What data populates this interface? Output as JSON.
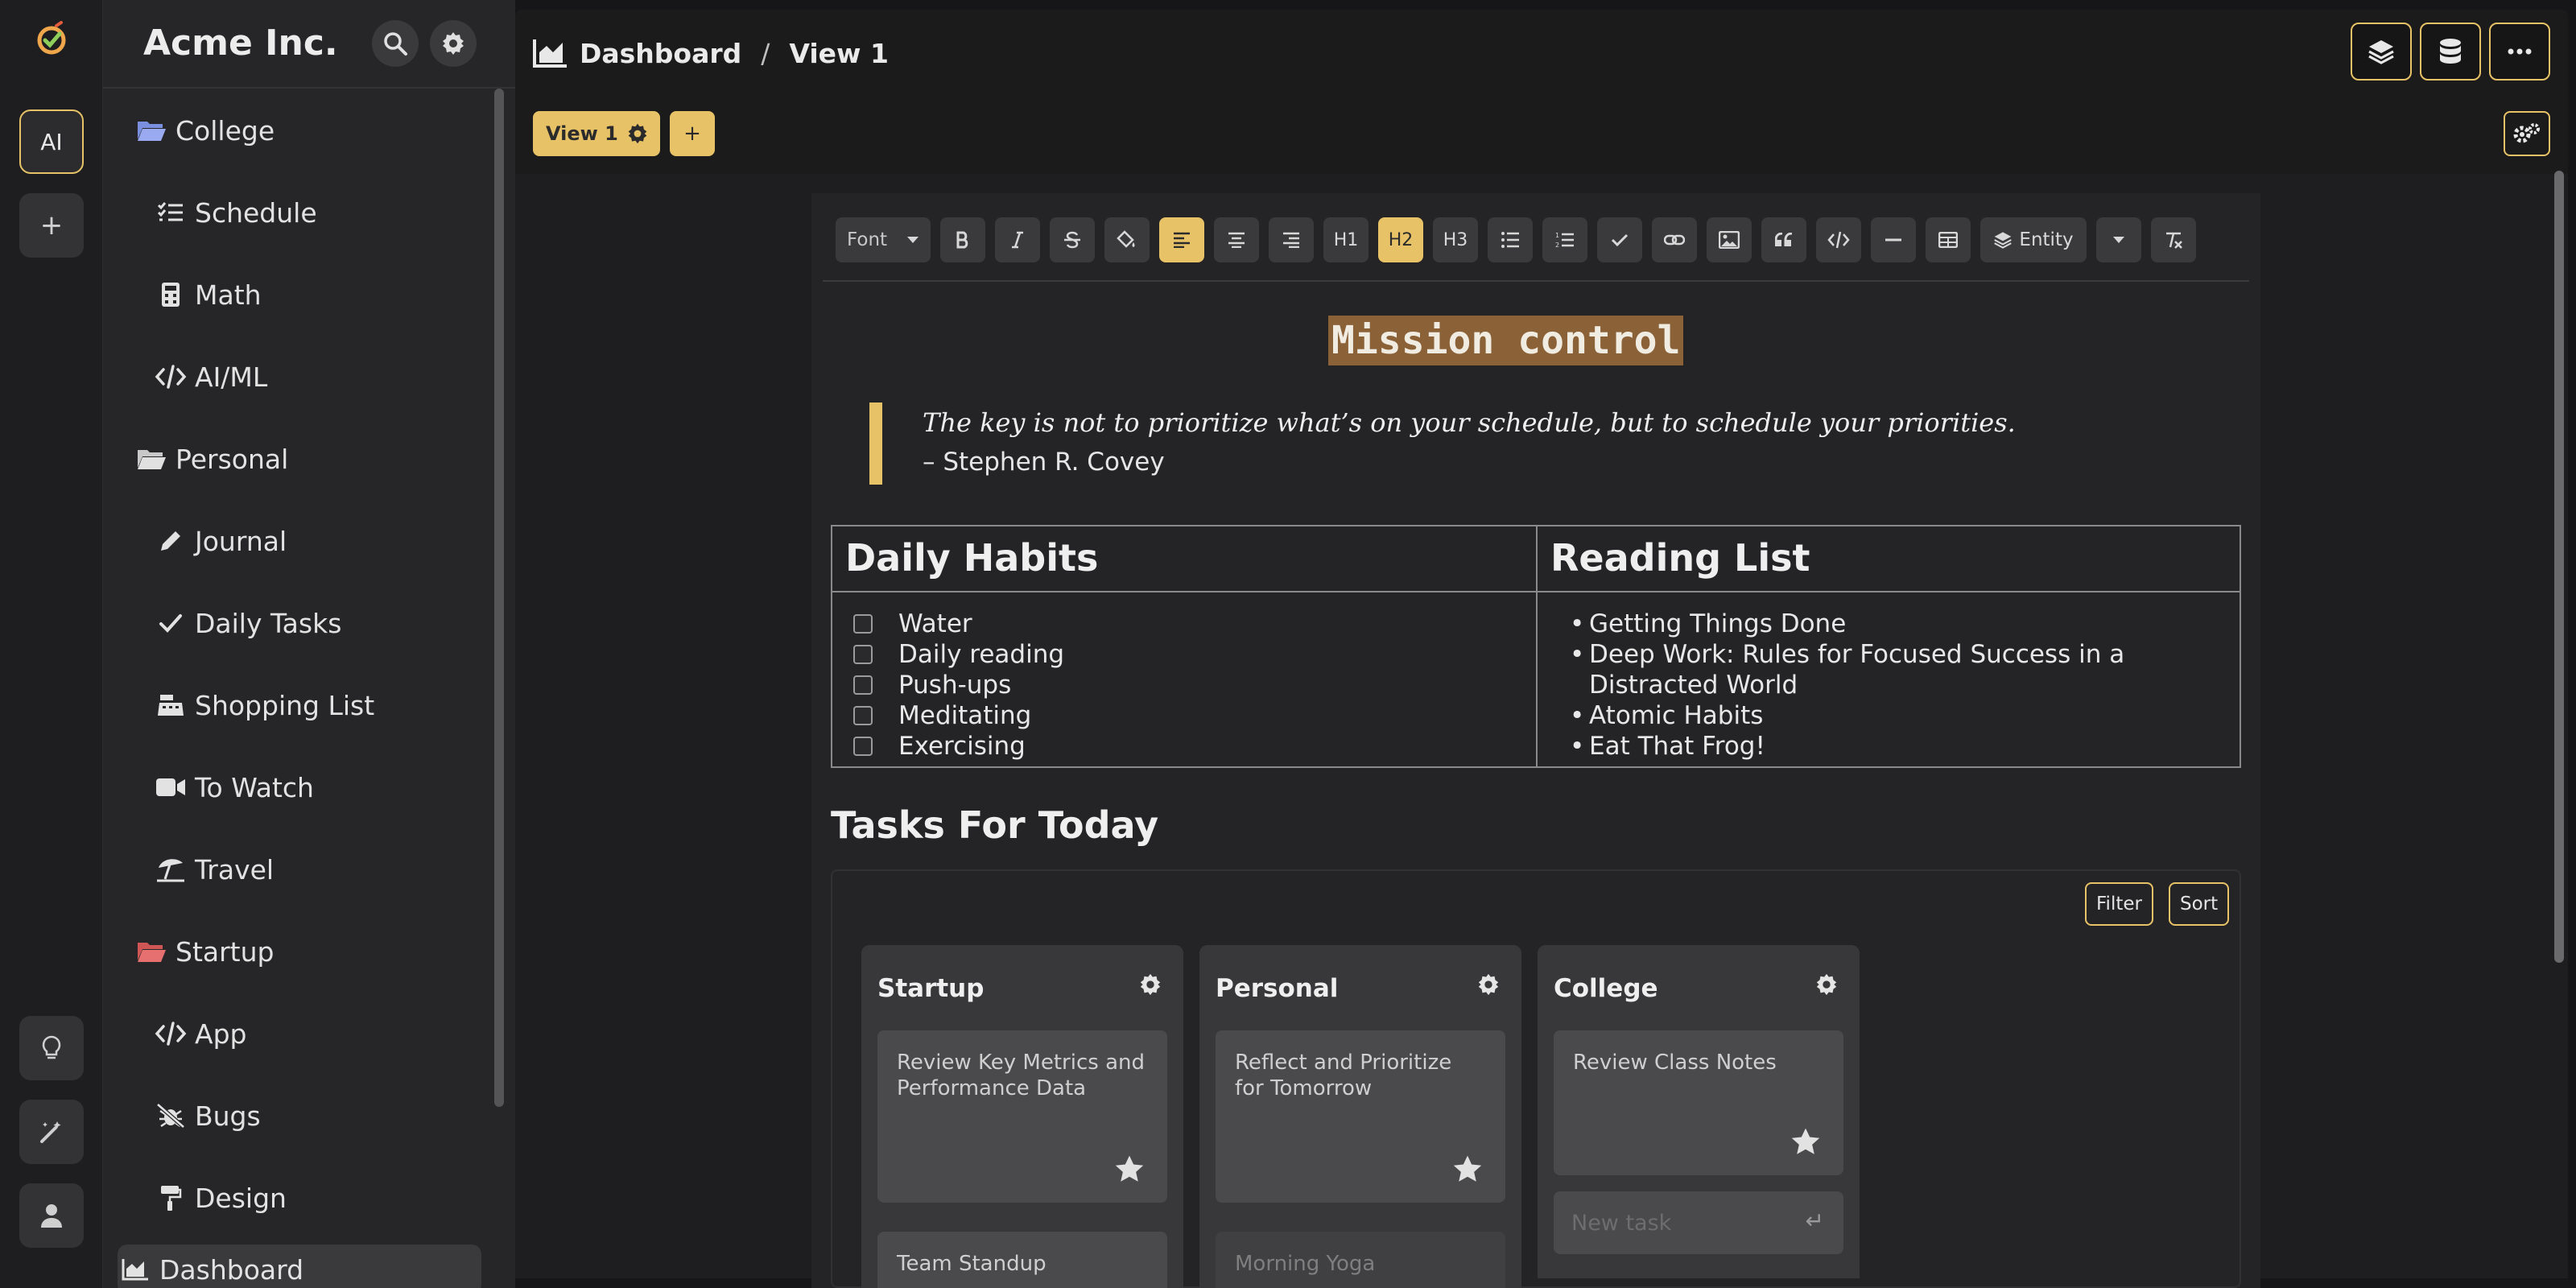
{
  "rail": {
    "ai_label": "AI",
    "add_label": "+"
  },
  "sidebar": {
    "org_name": "Acme Inc.",
    "items": [
      {
        "label": "College",
        "icon": "folder-open-icon",
        "color": "#7b8fe0"
      },
      {
        "label": "Schedule",
        "icon": "list-check-icon"
      },
      {
        "label": "Math",
        "icon": "calculator-icon"
      },
      {
        "label": "AI/ML",
        "icon": "code-icon"
      },
      {
        "label": "Personal",
        "icon": "folder-open-icon",
        "color": "#d6d6d6"
      },
      {
        "label": "Journal",
        "icon": "pencil-icon"
      },
      {
        "label": "Daily Tasks",
        "icon": "check-icon"
      },
      {
        "label": "Shopping List",
        "icon": "cash-register-icon"
      },
      {
        "label": "To Watch",
        "icon": "video-icon"
      },
      {
        "label": "Travel",
        "icon": "umbrella-beach-icon"
      },
      {
        "label": "Startup",
        "icon": "folder-open-icon",
        "color": "#e06a6a"
      },
      {
        "label": "App",
        "icon": "code-icon"
      },
      {
        "label": "Bugs",
        "icon": "bug-slash-icon"
      },
      {
        "label": "Design",
        "icon": "paint-roller-icon"
      },
      {
        "label": "Dashboard",
        "icon": "chart-area-icon"
      }
    ]
  },
  "header": {
    "crumb_root": "Dashboard",
    "crumb_separator": "/",
    "crumb_current": "View 1"
  },
  "tabs": {
    "active_label": "View 1",
    "add_label": "+"
  },
  "toolbar": {
    "font_label": "Font",
    "h1": "H1",
    "h2": "H2",
    "h3": "H3",
    "entity_label": "Entity",
    "active": [
      "align-left",
      "h2"
    ]
  },
  "doc": {
    "title": "Mission control",
    "quote": "The key is not to prioritize what’s on your schedule, but to schedule your priorities.",
    "quote_author": "– Stephen R. Covey",
    "habits_header": "Daily Habits",
    "reading_header": "Reading List",
    "habits": [
      "Water",
      "Daily reading",
      "Push-ups",
      "Meditating",
      "Exercising"
    ],
    "books": [
      "Getting Things Done",
      "Deep Work: Rules for Focused Success in a Distracted World",
      "Atomic Habits",
      "Eat That Frog!"
    ],
    "tasks_title": "Tasks For Today"
  },
  "board": {
    "filter_label": "Filter",
    "sort_label": "Sort",
    "new_task_placeholder": "New task",
    "columns": [
      {
        "title": "Startup",
        "cards": [
          "Review Key Metrics and Performance Data",
          "Team Standup"
        ]
      },
      {
        "title": "Personal",
        "cards": [
          "Reflect and Prioritize for Tomorrow",
          "Morning Yoga"
        ]
      },
      {
        "title": "College",
        "cards": [
          "Review Class Notes"
        ]
      }
    ]
  },
  "colors": {
    "accent": "#e8c266",
    "highlight": "#8b6138",
    "background": "#161618"
  }
}
